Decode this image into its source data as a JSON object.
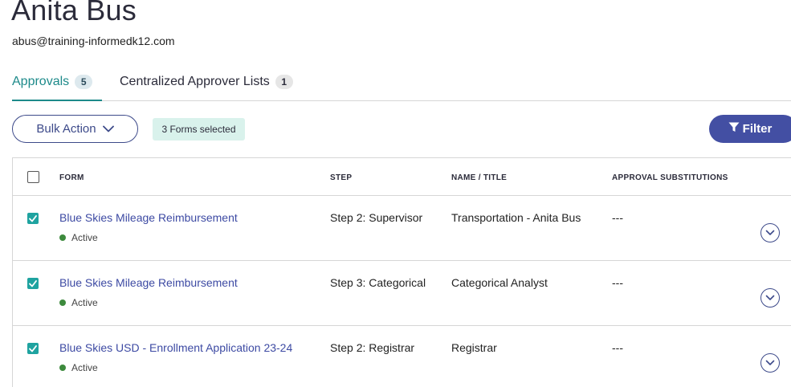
{
  "user": {
    "name": "Anita Bus",
    "email": "abus@training-informedk12.com"
  },
  "tabs": [
    {
      "label": "Approvals",
      "count": "5"
    },
    {
      "label": "Centralized Approver Lists",
      "count": "1"
    }
  ],
  "toolbar": {
    "bulk_action_label": "Bulk Action",
    "selected_label": "3 Forms selected",
    "filter_label": "Filter"
  },
  "table": {
    "headers": {
      "form": "FORM",
      "step": "STEP",
      "name_title": "NAME / TITLE",
      "substitutions": "APPROVAL SUBSTITUTIONS"
    },
    "rows": [
      {
        "form": "Blue Skies Mileage Reimbursement",
        "status": "Active",
        "step": "Step 2: Supervisor",
        "name_title": "Transportation - Anita Bus",
        "substitutions": "---",
        "checked": true
      },
      {
        "form": "Blue Skies Mileage Reimbursement",
        "status": "Active",
        "step": "Step 3: Categorical",
        "name_title": "Categorical Analyst",
        "substitutions": "---",
        "checked": true
      },
      {
        "form": "Blue Skies USD - Enrollment Application 23-24",
        "status": "Active",
        "step": "Step 2: Registrar",
        "name_title": "Registrar",
        "substitutions": "---",
        "checked": true
      }
    ]
  },
  "colors": {
    "accent_teal": "#1d8a8a",
    "primary_indigo": "#434fa3",
    "selected_badge_bg": "#d9f2ec",
    "checkbox_checked": "#1fa3a0",
    "status_active": "#3d8a3d"
  },
  "icons": {
    "bulk_action": "chevron-down-icon",
    "filter": "funnel-icon",
    "row_expand": "chevron-down-circle-icon",
    "checkbox": "checkmark-icon"
  }
}
